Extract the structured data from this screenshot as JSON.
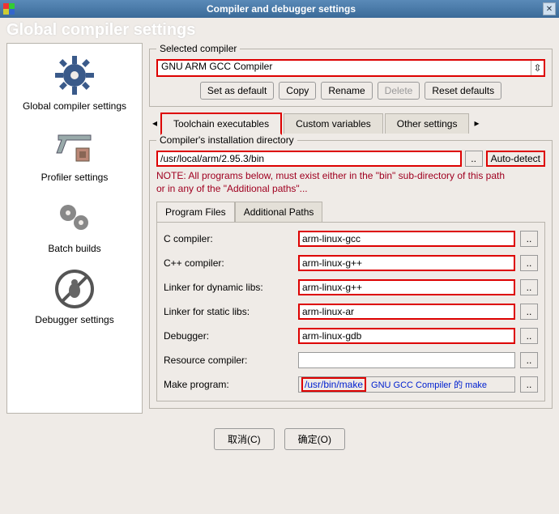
{
  "window": {
    "title": "Compiler and debugger settings"
  },
  "header": {
    "subtitle": "Global compiler settings"
  },
  "sidebar": {
    "items": [
      {
        "label": "Global compiler settings"
      },
      {
        "label": "Profiler settings"
      },
      {
        "label": "Batch builds"
      },
      {
        "label": "Debugger settings"
      }
    ]
  },
  "selected_compiler": {
    "legend": "Selected compiler",
    "value": "GNU ARM GCC Compiler",
    "buttons": {
      "set_default": "Set as default",
      "copy": "Copy",
      "rename": "Rename",
      "delete": "Delete",
      "reset": "Reset defaults"
    }
  },
  "tabs": {
    "toolchain": "Toolchain executables",
    "customvars": "Custom variables",
    "other": "Other settings"
  },
  "install_dir": {
    "legend": "Compiler's installation directory",
    "value": "/usr/local/arm/2.95.3/bin",
    "autodetect": "Auto-detect",
    "note1": "NOTE: All programs below, must exist either in the \"bin\" sub-directory of this path",
    "note2": "or in any of the \"Additional paths\"..."
  },
  "subtabs": {
    "pf": "Program Files",
    "ap": "Additional Paths"
  },
  "programs": {
    "c_compiler": {
      "label": "C compiler:",
      "value": "arm-linux-gcc"
    },
    "cxx_compiler": {
      "label": "C++ compiler:",
      "value": "arm-linux-g++"
    },
    "linker_dyn": {
      "label": "Linker for dynamic libs:",
      "value": "arm-linux-g++"
    },
    "linker_static": {
      "label": "Linker for static libs:",
      "value": "arm-linux-ar"
    },
    "debugger": {
      "label": "Debugger:",
      "value": "arm-linux-gdb"
    },
    "resource": {
      "label": "Resource compiler:",
      "value": ""
    },
    "make": {
      "label": "Make program:",
      "value": "/usr/bin/make",
      "extra": "GNU GCC Compiler 的 make"
    }
  },
  "dialog": {
    "cancel": "取消(C)",
    "ok": "确定(O)"
  }
}
